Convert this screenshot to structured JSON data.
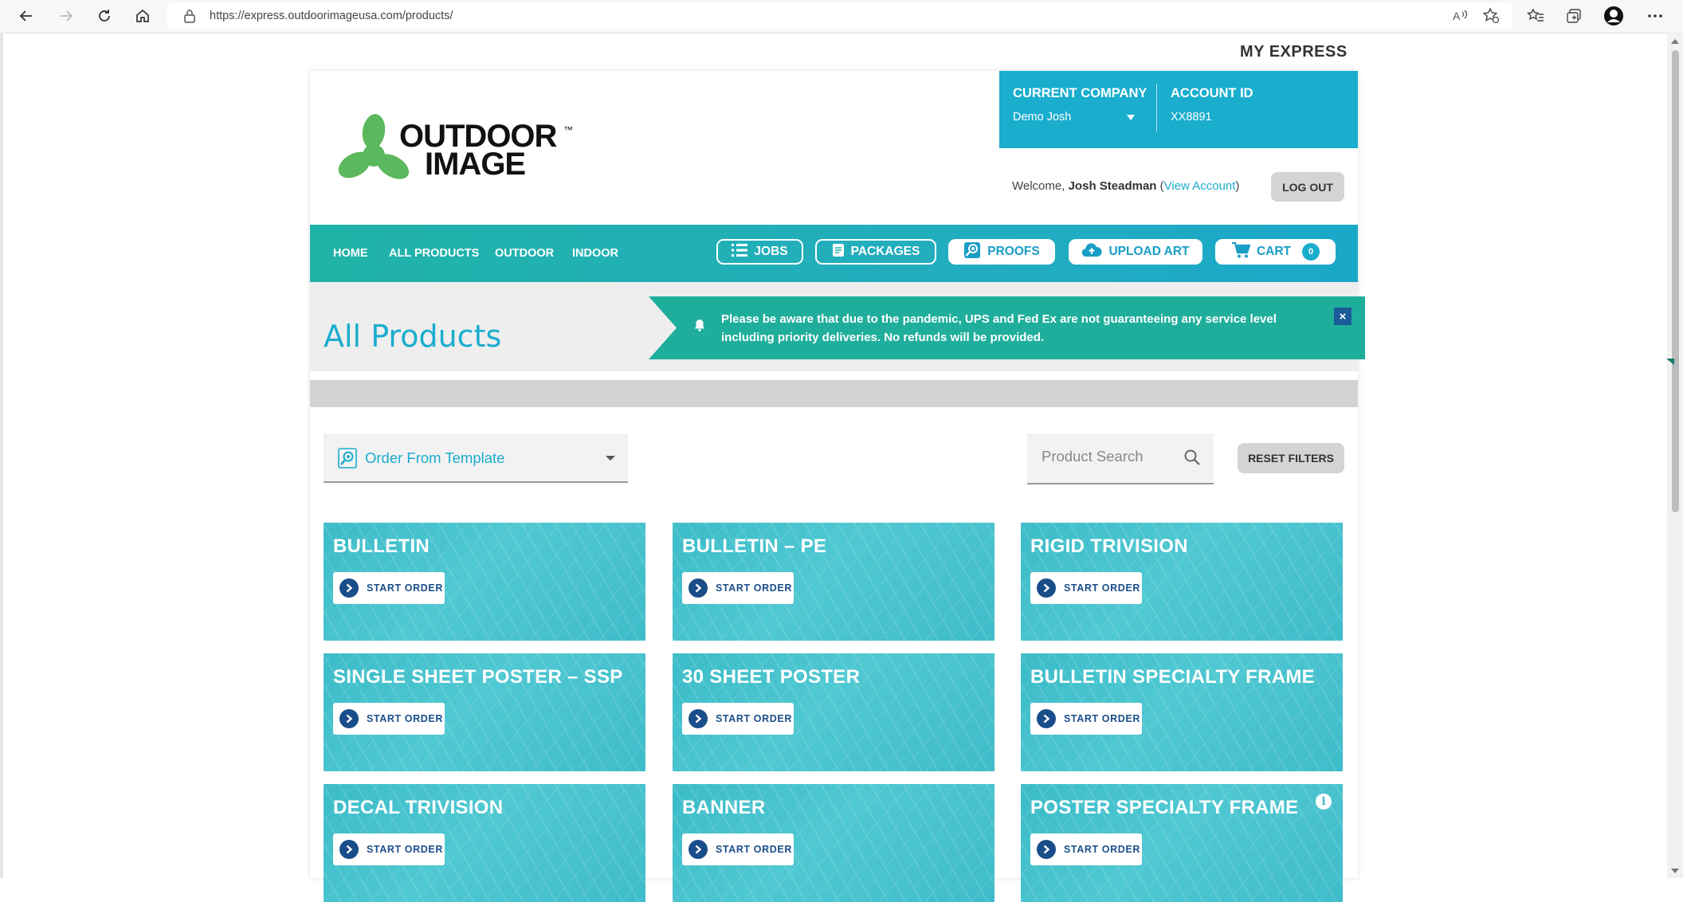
{
  "browser": {
    "url": "https://express.outdoorimageusa.com/products/"
  },
  "top_link": "MY EXPRESS",
  "header": {
    "logo_text_line1": "OUTDOOR",
    "logo_text_line2": "IMAGE",
    "logo_tm": "™",
    "company_label": "CURRENT COMPANY",
    "company_value": "Demo Josh",
    "account_label": "ACCOUNT ID",
    "account_value": "XX8891",
    "welcome_prefix": "Welcome,",
    "welcome_user": "Josh Steadman",
    "welcome_open": "(",
    "view_account": "View Account",
    "welcome_close": ")",
    "logout": "LOG OUT"
  },
  "nav": {
    "links": [
      "HOME",
      "ALL PRODUCTS",
      "OUTDOOR",
      "INDOOR"
    ],
    "jobs": "JOBS",
    "packages": "PACKAGES",
    "proofs": "PROOFS",
    "upload_art": "UPLOAD ART",
    "cart": "CART",
    "cart_count": "0"
  },
  "page": {
    "title": "All Products",
    "notice": "Please be aware that due to the pandemic, UPS and Fed Ex are not guaranteeing any service level including priority deliveries. No refunds will be provided.",
    "notice_close": "×"
  },
  "filters": {
    "template_label": "Order From Template",
    "search_placeholder": "Product Search",
    "reset": "RESET FILTERS"
  },
  "products": [
    {
      "name": "BULLETIN",
      "button": "START ORDER"
    },
    {
      "name": "BULLETIN – PE",
      "button": "START ORDER"
    },
    {
      "name": "RIGID TRIVISION",
      "button": "START ORDER"
    },
    {
      "name": "SINGLE SHEET POSTER – SSP",
      "button": "START ORDER"
    },
    {
      "name": "30 SHEET POSTER",
      "button": "START ORDER"
    },
    {
      "name": "BULLETIN SPECIALTY FRAME",
      "button": "START ORDER"
    },
    {
      "name": "DECAL TRIVISION",
      "button": "START ORDER"
    },
    {
      "name": "BANNER",
      "button": "START ORDER"
    },
    {
      "name": "POSTER SPECIALTY FRAME",
      "button": "START ORDER",
      "info": "i"
    }
  ],
  "colors": {
    "accent": "#1aadce",
    "nav_teal": "#1fb3a7",
    "notice": "#1fae9c",
    "dark_blue": "#1a4e8a",
    "logo_green": "#5cb85c"
  }
}
